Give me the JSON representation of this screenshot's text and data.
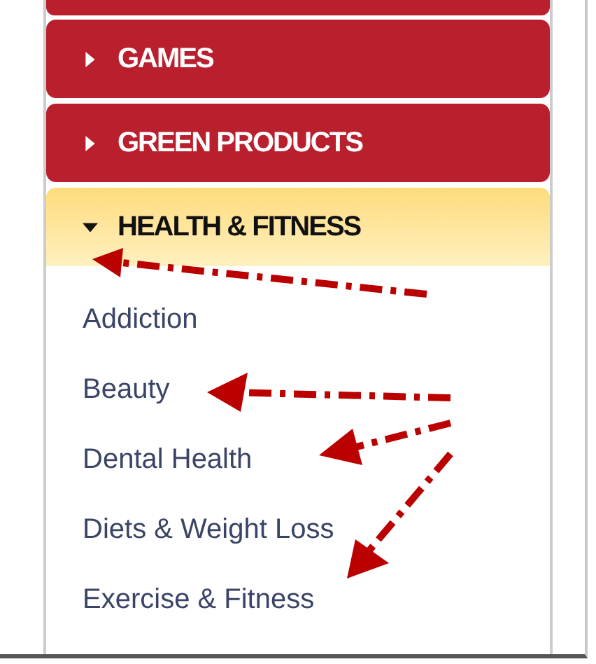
{
  "categories": [
    {
      "label": "GAMES",
      "expanded": false
    },
    {
      "label": "GREEN PRODUCTS",
      "expanded": false
    },
    {
      "label": "HEALTH & FITNESS",
      "expanded": true,
      "children": [
        {
          "label": "Addiction"
        },
        {
          "label": "Beauty"
        },
        {
          "label": "Dental Health"
        },
        {
          "label": "Diets & Weight Loss"
        },
        {
          "label": "Exercise & Fitness"
        }
      ]
    }
  ]
}
